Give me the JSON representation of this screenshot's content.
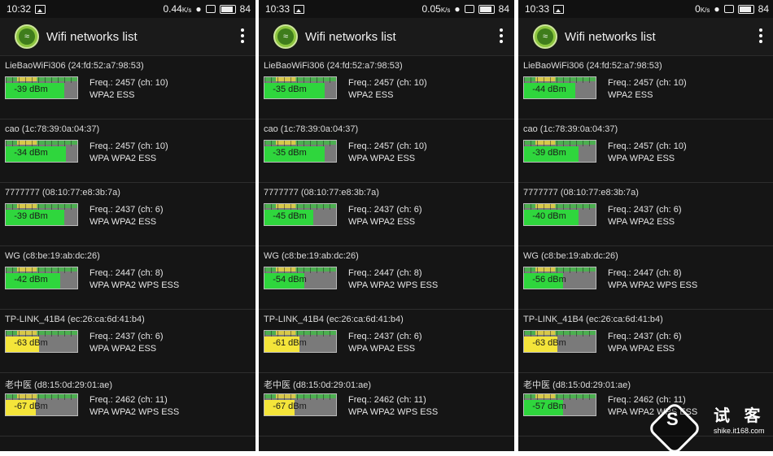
{
  "panels": [
    {
      "status": {
        "time": "10:32",
        "speed": "0.44",
        "speed_unit": "K/s",
        "battery": "84"
      },
      "title": "Wifi networks list",
      "networks": [
        {
          "ssid": "LieBaoWiFi306 (24:fd:52:a7:98:53)",
          "dbm": "-39 dBm",
          "level": 0.82,
          "color": "green",
          "freq": "Freq.: 2457 (ch: 10)",
          "security": "WPA2 ESS"
        },
        {
          "ssid": "cao (1c:78:39:0a:04:37)",
          "dbm": "-34 dBm",
          "level": 0.84,
          "color": "green",
          "freq": "Freq.: 2457 (ch: 10)",
          "security": "WPA WPA2 ESS"
        },
        {
          "ssid": "7777777 (08:10:77:e8:3b:7a)",
          "dbm": "-39 dBm",
          "level": 0.82,
          "color": "green",
          "freq": "Freq.: 2437 (ch: 6)",
          "security": "WPA WPA2 ESS"
        },
        {
          "ssid": "WG (c8:be:19:ab:dc:26)",
          "dbm": "-42 dBm",
          "level": 0.76,
          "color": "green",
          "freq": "Freq.: 2447 (ch: 8)",
          "security": "WPA WPA2 WPS ESS"
        },
        {
          "ssid": "TP-LINK_41B4 (ec:26:ca:6d:41:b4)",
          "dbm": "-63 dBm",
          "level": 0.47,
          "color": "yellow",
          "freq": "Freq.: 2437 (ch: 6)",
          "security": "WPA WPA2 ESS"
        },
        {
          "ssid": "老中医 (d8:15:0d:29:01:ae)",
          "dbm": "-67 dBm",
          "level": 0.42,
          "color": "yellow",
          "freq": "Freq.: 2462 (ch: 11)",
          "security": "WPA WPA2 WPS ESS"
        }
      ]
    },
    {
      "status": {
        "time": "10:33",
        "speed": "0.05",
        "speed_unit": "K/s",
        "battery": "84"
      },
      "title": "Wifi networks list",
      "networks": [
        {
          "ssid": "LieBaoWiFi306 (24:fd:52:a7:98:53)",
          "dbm": "-35 dBm",
          "level": 0.84,
          "color": "green",
          "freq": "Freq.: 2457 (ch: 10)",
          "security": "WPA2 ESS"
        },
        {
          "ssid": "cao (1c:78:39:0a:04:37)",
          "dbm": "-35 dBm",
          "level": 0.84,
          "color": "green",
          "freq": "Freq.: 2457 (ch: 10)",
          "security": "WPA WPA2 ESS"
        },
        {
          "ssid": "7777777 (08:10:77:e8:3b:7a)",
          "dbm": "-45 dBm",
          "level": 0.68,
          "color": "green",
          "freq": "Freq.: 2437 (ch: 6)",
          "security": "WPA WPA2 ESS"
        },
        {
          "ssid": "WG (c8:be:19:ab:dc:26)",
          "dbm": "-54 dBm",
          "level": 0.56,
          "color": "green",
          "freq": "Freq.: 2447 (ch: 8)",
          "security": "WPA WPA2 WPS ESS"
        },
        {
          "ssid": "TP-LINK_41B4 (ec:26:ca:6d:41:b4)",
          "dbm": "-61 dBm",
          "level": 0.49,
          "color": "yellow",
          "freq": "Freq.: 2437 (ch: 6)",
          "security": "WPA WPA2 ESS"
        },
        {
          "ssid": "老中医 (d8:15:0d:29:01:ae)",
          "dbm": "-67 dBm",
          "level": 0.42,
          "color": "yellow",
          "freq": "Freq.: 2462 (ch: 11)",
          "security": "WPA WPA2 WPS ESS"
        }
      ]
    },
    {
      "status": {
        "time": "10:33",
        "speed": "0",
        "speed_unit": "K/s",
        "battery": "84"
      },
      "title": "Wifi networks list",
      "networks": [
        {
          "ssid": "LieBaoWiFi306 (24:fd:52:a7:98:53)",
          "dbm": "-44 dBm",
          "level": 0.72,
          "color": "green",
          "freq": "Freq.: 2457 (ch: 10)",
          "security": "WPA2 ESS"
        },
        {
          "ssid": "cao (1c:78:39:0a:04:37)",
          "dbm": "-39 dBm",
          "level": 0.76,
          "color": "green",
          "freq": "Freq.: 2457 (ch: 10)",
          "security": "WPA WPA2 ESS"
        },
        {
          "ssid": "7777777 (08:10:77:e8:3b:7a)",
          "dbm": "-40 dBm",
          "level": 0.76,
          "color": "green",
          "freq": "Freq.: 2437 (ch: 6)",
          "security": "WPA WPA2 ESS"
        },
        {
          "ssid": "WG (c8:be:19:ab:dc:26)",
          "dbm": "-56 dBm",
          "level": 0.54,
          "color": "green",
          "freq": "Freq.: 2447 (ch: 8)",
          "security": "WPA WPA2 WPS ESS"
        },
        {
          "ssid": "TP-LINK_41B4 (ec:26:ca:6d:41:b4)",
          "dbm": "-63 dBm",
          "level": 0.47,
          "color": "yellow",
          "freq": "Freq.: 2437 (ch: 6)",
          "security": "WPA WPA2 ESS"
        },
        {
          "ssid": "老中医 (d8:15:0d:29:01:ae)",
          "dbm": "-57 dBm",
          "level": 0.54,
          "color": "green",
          "freq": "Freq.: 2462 (ch: 11)",
          "security": "WPA WPA2 WPS ESS"
        }
      ]
    }
  ],
  "watermark": {
    "text": "试 客",
    "url": "shike.it168.com",
    "logo_letter": "S"
  },
  "colors": {
    "green": "#2fd63d",
    "yellow": "#f4e53a",
    "background": "#151515"
  }
}
